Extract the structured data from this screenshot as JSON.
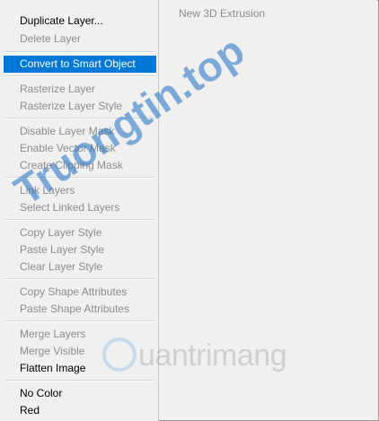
{
  "context_menu": {
    "items": [
      {
        "label": "Duplicate Layer...",
        "enabled": true
      },
      {
        "label": "Delete Layer",
        "enabled": false
      },
      {
        "label": "Convert to Smart Object",
        "enabled": true,
        "selected": true
      },
      {
        "label": "Rasterize Layer",
        "enabled": false
      },
      {
        "label": "Rasterize Layer Style",
        "enabled": false
      },
      {
        "label": "Disable Layer Mask",
        "enabled": false
      },
      {
        "label": "Enable Vector Mask",
        "enabled": false
      },
      {
        "label": "Create Clipping Mask",
        "enabled": false
      },
      {
        "label": "Link Layers",
        "enabled": false
      },
      {
        "label": "Select Linked Layers",
        "enabled": false
      },
      {
        "label": "Copy Layer Style",
        "enabled": false
      },
      {
        "label": "Paste Layer Style",
        "enabled": false
      },
      {
        "label": "Clear Layer Style",
        "enabled": false
      },
      {
        "label": "Copy Shape Attributes",
        "enabled": false
      },
      {
        "label": "Paste Shape Attributes",
        "enabled": false
      },
      {
        "label": "Merge Layers",
        "enabled": false
      },
      {
        "label": "Merge Visible",
        "enabled": false
      },
      {
        "label": "Flatten Image",
        "enabled": true
      },
      {
        "label": "No Color",
        "enabled": true
      },
      {
        "label": "Red",
        "enabled": true
      }
    ]
  },
  "right_panel": {
    "item_label": "New 3D Extrusion"
  },
  "watermarks": {
    "top": "Truongtin.top",
    "bottom": "uantrimang"
  },
  "colors": {
    "selection": "#0078d7",
    "disabled_text": "#8d8d8d",
    "menu_bg": "#f0f0f0",
    "watermark_top": "#1f6fc4",
    "watermark_top_accent": "#e8485a"
  }
}
